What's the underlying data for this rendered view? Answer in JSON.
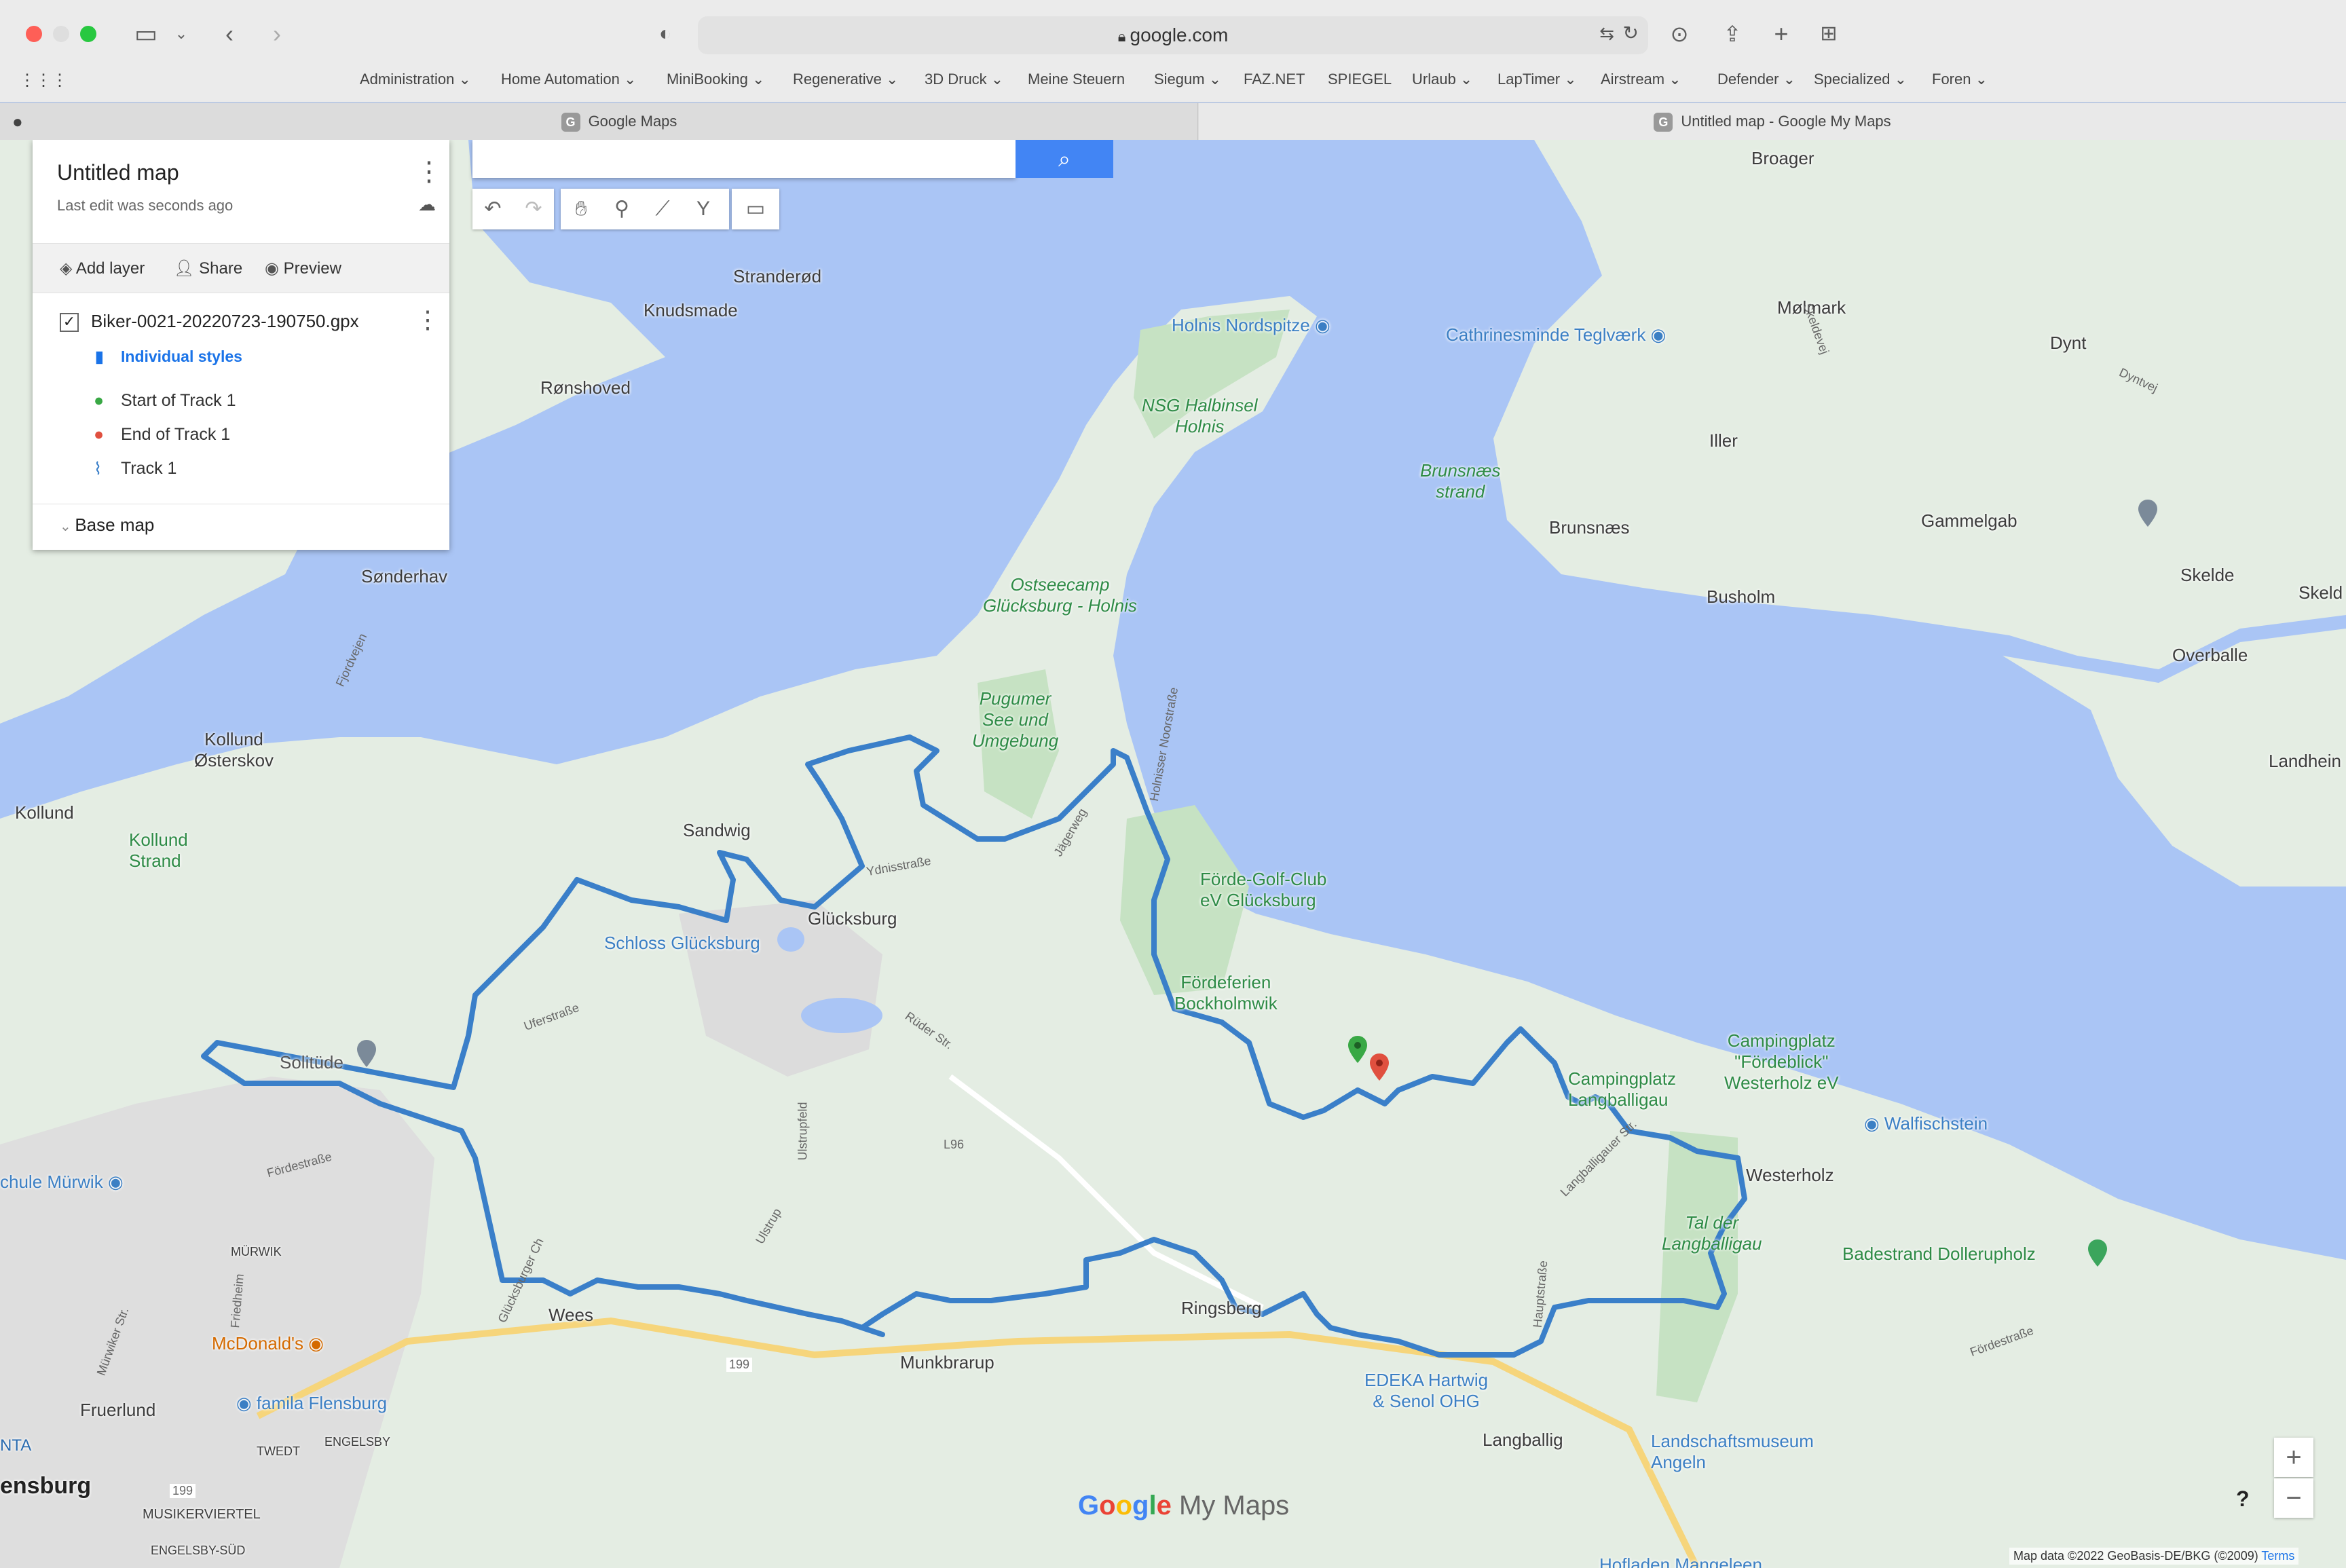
{
  "browser": {
    "url": "google.com",
    "bookmarks": [
      "Administration",
      "Home Automation",
      "MiniBooking",
      "Regenerative",
      "3D Druck",
      "Meine Steuern",
      "Siegum",
      "FAZ.NET",
      "SPIEGEL",
      "Urlaub",
      "LapTimer",
      "Airstream",
      "Defender",
      "Specialized",
      "Foren"
    ],
    "bookmark_dropdowns": [
      true,
      true,
      true,
      true,
      true,
      false,
      true,
      false,
      false,
      true,
      true,
      true,
      true,
      true,
      true
    ],
    "tabs": [
      {
        "title": "Google Maps",
        "favicon": "G"
      },
      {
        "title": "Untitled map - Google My Maps",
        "favicon": "G"
      }
    ]
  },
  "panel": {
    "title": "Untitled map",
    "subtitle": "Last edit was seconds ago",
    "actions": {
      "add_layer": "Add layer",
      "share": "Share",
      "preview": "Preview"
    },
    "layer": {
      "name": "Biker-0021-20220723-190750.gpx",
      "styles": "Individual styles",
      "items": [
        "Start of Track 1",
        "End of Track 1",
        "Track 1"
      ]
    },
    "base_map": "Base map"
  },
  "map": {
    "places": [
      {
        "id": "broager",
        "name": "Broager"
      },
      {
        "id": "strandered",
        "name": "Stranderød"
      },
      {
        "id": "knudsmade",
        "name": "Knudsmade"
      },
      {
        "id": "ronshoved",
        "name": "Rønshoved"
      },
      {
        "id": "molmark",
        "name": "Mølmark"
      },
      {
        "id": "dynt",
        "name": "Dynt"
      },
      {
        "id": "iller",
        "name": "Iller"
      },
      {
        "id": "brunsnaes",
        "name": "Brunsnæs"
      },
      {
        "id": "gammelgab",
        "name": "Gammelgab"
      },
      {
        "id": "skelde",
        "name": "Skelde"
      },
      {
        "id": "skeld",
        "name": "Skeld"
      },
      {
        "id": "busholm",
        "name": "Busholm"
      },
      {
        "id": "overballe",
        "name": "Overballe"
      },
      {
        "id": "landhein",
        "name": "Landhein"
      },
      {
        "id": "sonderhav",
        "name": "Sønderhav"
      },
      {
        "id": "kollund-osterskov",
        "name": "Kollund\nØsterskov"
      },
      {
        "id": "kollund",
        "name": "Kollund"
      },
      {
        "id": "sandwig",
        "name": "Sandwig"
      },
      {
        "id": "glucksburg",
        "name": "Glücksburg"
      },
      {
        "id": "westerholz",
        "name": "Westerholz"
      },
      {
        "id": "wees",
        "name": "Wees"
      },
      {
        "id": "ringsberg",
        "name": "Ringsberg"
      },
      {
        "id": "munkbrarup",
        "name": "Munkbrarup"
      },
      {
        "id": "fruerlund",
        "name": "Fruerlund"
      },
      {
        "id": "langballig",
        "name": "Langballig"
      },
      {
        "id": "flensburg",
        "name": "ensburg"
      },
      {
        "id": "murwik",
        "name": "MÜRWIK"
      },
      {
        "id": "twedt",
        "name": "TWEDT"
      },
      {
        "id": "engelsby",
        "name": "ENGELSBY"
      },
      {
        "id": "musikerviertel",
        "name": "MUSIKERVIERTEL"
      },
      {
        "id": "engelsby-sud",
        "name": "ENGELSBY-SÜD"
      },
      {
        "id": "nta",
        "name": "NTA"
      }
    ],
    "pois": [
      {
        "id": "holnis-nordspitze",
        "name": "Holnis Nordspitze",
        "color": "blue"
      },
      {
        "id": "teglvaerk",
        "name": "Cathrinesminde Teglværk",
        "color": "blue"
      },
      {
        "id": "nsg-holnis",
        "name": "NSG Halbinsel\nHolnis",
        "color": "green"
      },
      {
        "id": "brunsnaes-strand",
        "name": "Brunsnæs\nstrand",
        "color": "green"
      },
      {
        "id": "ostseecamp",
        "name": "Ostseecamp\nGlücksburg - Holnis",
        "color": "green"
      },
      {
        "id": "pugumer-see",
        "name": "Pugumer\nSee und\nUmgebung",
        "color": "green"
      },
      {
        "id": "kollund-strand",
        "name": "Kollund\nStrand",
        "color": "green"
      },
      {
        "id": "golf-club",
        "name": "Förde-Golf-Club\neV Glücksburg",
        "color": "green"
      },
      {
        "id": "schloss",
        "name": "Schloss Glücksburg",
        "color": "blue"
      },
      {
        "id": "foerdeferien",
        "name": "Fördeferien\nBockholmwik",
        "color": "green"
      },
      {
        "id": "solitude",
        "name": "Solitüde",
        "color": "gray"
      },
      {
        "id": "campingplatz-foerdeblick",
        "name": "Campingplatz\n\"Fördeblick\"\nWesterholz eV",
        "color": "green"
      },
      {
        "id": "campingplatz-langballigau",
        "name": "Campingplatz\nLangballigau",
        "color": "green"
      },
      {
        "id": "walfischstein",
        "name": "Walfischstein",
        "color": "blue"
      },
      {
        "id": "tal-der-langballigau",
        "name": "Tal der\nLangballigau",
        "color": "green"
      },
      {
        "id": "badestrand",
        "name": "Badestrand Dollerupholz",
        "color": "green"
      },
      {
        "id": "schule-murwik",
        "name": "chule Mürwik",
        "color": "blue"
      },
      {
        "id": "mcdonalds",
        "name": "McDonald's",
        "color": "orange"
      },
      {
        "id": "famila",
        "name": "famila Flensburg",
        "color": "blue"
      },
      {
        "id": "edeka",
        "name": "EDEKA Hartwig\n& Senol OHG",
        "color": "blue"
      },
      {
        "id": "landschaftsmuseum",
        "name": "Landschaftsmuseum\nAngeln",
        "color": "blue"
      },
      {
        "id": "hofladen",
        "name": "Hofladen Mangeleen",
        "color": "blue"
      }
    ],
    "roads": [
      {
        "id": "holnisser",
        "name": "Holnisser Noorstraße"
      },
      {
        "id": "jagerweg",
        "name": "Jägerweg"
      },
      {
        "id": "ydnisstrasse",
        "name": "Ydnisstraße"
      },
      {
        "id": "uferstrasse",
        "name": "Uferstraße"
      },
      {
        "id": "rudner",
        "name": "Rüder Str."
      },
      {
        "id": "l96",
        "name": "L96"
      },
      {
        "id": "ulstrupfeld",
        "name": "Ulstrupfeld"
      },
      {
        "id": "ulstrup",
        "name": "Ulstrup"
      },
      {
        "id": "forde",
        "name": "Fördestraße"
      },
      {
        "id": "glucksburger",
        "name": "Glücksburger Ch"
      },
      {
        "id": "langballigauer",
        "name": "Langballigauer Str."
      },
      {
        "id": "hauptstrasse",
        "name": "Hauptstraße"
      },
      {
        "id": "fordestrasse2",
        "name": "Fördestraße"
      },
      {
        "id": "road199",
        "name": "199"
      },
      {
        "id": "road199b",
        "name": "199"
      },
      {
        "id": "friedheim",
        "name": "Friedheim"
      },
      {
        "id": "murwikerstr",
        "name": "Mürwiker Str."
      },
      {
        "id": "skeldevej",
        "name": "Skeldevej"
      },
      {
        "id": "dyntvej",
        "name": "Dyntvej"
      },
      {
        "id": "fjordvejen",
        "name": "Fjordvejen"
      }
    ],
    "logo": {
      "google": "Google",
      "mymaps": "My Maps"
    },
    "attribution": "Map data ©2022 GeoBasis-DE/BKG (©2009)",
    "terms": "Terms",
    "zoom_in": "+",
    "zoom_out": "−",
    "track_color": "#3a7fc9",
    "land_color": "#e4ede3",
    "water_color": "#aac5f5"
  }
}
